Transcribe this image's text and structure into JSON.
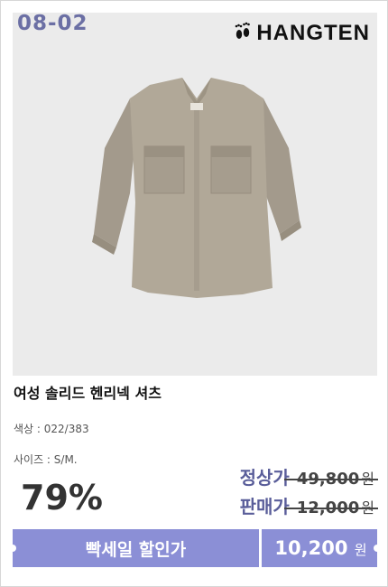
{
  "badge": {
    "code": "08-02"
  },
  "brand": {
    "name": "HANGTEN",
    "icon": "footprints-icon"
  },
  "product": {
    "title": "여성 솔리드 헨리넥 셔츠",
    "color_label": "색상 : 022/383",
    "size_label": "사이즈 : S/M."
  },
  "pricing": {
    "discount": "79%",
    "regular_label": "정상가",
    "regular_price": "49,800",
    "sale_label": "판매가",
    "sale_price": "12,000",
    "currency": "원"
  },
  "banner": {
    "event_label": "빡세일 할인가",
    "final_price": "10,200",
    "currency": "원",
    "color": "#8b8fd6"
  }
}
